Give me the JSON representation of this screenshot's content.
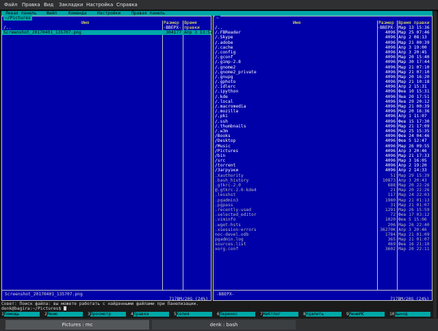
{
  "app_menu": [
    "Файл",
    "Правка",
    "Вид",
    "Закладки",
    "Настройка",
    "Справка"
  ],
  "mc_menu": [
    "Левая панель",
    "Файл",
    "Команда",
    "Настройки",
    "Правая панель"
  ],
  "left_panel": {
    "path": "~/Pictures",
    "col_name": "Имя",
    "col_size": "Размер",
    "col_time": "Время правки",
    "rows": [
      {
        "name": "/..",
        "size": "-ВВЕРХ-",
        "time": "",
        "kind": "dir"
      },
      {
        "name": " Screenshot_20170401_135707.png",
        "size": "304177",
        "time": "Апр  3 13:57",
        "kind": "sel"
      }
    ],
    "footer": "Screenshot_20170401_135707.png",
    "space": "717ВМ/20G (24%)"
  },
  "right_panel": {
    "path": "~",
    "col_name": "Имя",
    "col_size": "Размер",
    "col_time": "Время правки",
    "rows": [
      {
        "name": "/..",
        "size": "-ВВЕРХ-",
        "time": "Мар 13 15:36",
        "kind": "dir"
      },
      {
        "name": "/.FBReader",
        "size": "4096",
        "time": "Мар 25 07:46",
        "kind": "dir"
      },
      {
        "name": "/.Skype",
        "size": "4096",
        "time": "Апр  2 08:13",
        "kind": "dir"
      },
      {
        "name": "/.adobe",
        "size": "4096",
        "time": "Мар 21 00:39",
        "kind": "dir"
      },
      {
        "name": "/.cache",
        "size": "4096",
        "time": "Апр  3 19:00",
        "kind": "dir"
      },
      {
        "name": "/.config",
        "size": "4096",
        "time": "Апр  3 20:45",
        "kind": "dir"
      },
      {
        "name": "/.gconf",
        "size": "4096",
        "time": "Мар 20 15:40",
        "kind": "dir"
      },
      {
        "name": "/.gimp-2.8",
        "size": "4096",
        "time": "Мар 30 17:44",
        "kind": "dir"
      },
      {
        "name": "/.gnome2",
        "size": "4096",
        "time": "Мар 21 07:10",
        "kind": "dir"
      },
      {
        "name": "/.gnome2_private",
        "size": "4096",
        "time": "Мар 21 07:10",
        "kind": "dir"
      },
      {
        "name": "/.gnupg",
        "size": "4096",
        "time": "Мар 20 16:20",
        "kind": "dir"
      },
      {
        "name": "/.gphoto",
        "size": "4096",
        "time": "Мар 21 10:18",
        "kind": "dir"
      },
      {
        "name": "/.idlerc",
        "size": "4096",
        "time": "Апр  2 15:31",
        "kind": "dir"
      },
      {
        "name": "/.ipython",
        "size": "4096",
        "time": "Фев 10 15:31",
        "kind": "dir"
      },
      {
        "name": "/.kde",
        "size": "4096",
        "time": "Янв 20 17:51",
        "kind": "dir"
      },
      {
        "name": "/.local",
        "size": "4096",
        "time": "Янв 29 20:12",
        "kind": "dir"
      },
      {
        "name": "/.macromedia",
        "size": "4096",
        "time": "Мар 21 00:39",
        "kind": "dir"
      },
      {
        "name": "/.mozilla",
        "size": "4096",
        "time": "Мар 20 16:36",
        "kind": "dir"
      },
      {
        "name": "/.pki",
        "size": "4096",
        "time": "Апр  1 11:07",
        "kind": "dir"
      },
      {
        "name": "/.ssh",
        "size": "4096",
        "time": "Фев 15 17:30",
        "kind": "dir"
      },
      {
        "name": "/.thumbnails",
        "size": "4096",
        "time": "Мар 21 17:09",
        "kind": "dir"
      },
      {
        "name": "/.w3m",
        "size": "4096",
        "time": "Мар 25 15:35",
        "kind": "dir"
      },
      {
        "name": "/Books",
        "size": "4096",
        "time": "Фев 24 04:46",
        "kind": "dir"
      },
      {
        "name": "/Desktop",
        "size": "4096",
        "time": "Фев  5 12:47",
        "kind": "dir"
      },
      {
        "name": "/Music",
        "size": "4096",
        "time": "Мар 26 09:55",
        "kind": "dir"
      },
      {
        "name": "/Pictures",
        "size": "4096",
        "time": "Апр  3 20:46",
        "kind": "dir"
      },
      {
        "name": "/bin",
        "size": "4096",
        "time": "Мар 21 17:33",
        "kind": "dir"
      },
      {
        "name": "/src",
        "size": "4096",
        "time": "Мар  3 16:05",
        "kind": "dir"
      },
      {
        "name": "/torrent",
        "size": "4096",
        "time": "Апр  2 19:20",
        "kind": "dir"
      },
      {
        "name": "/Загрузки",
        "size": "4096",
        "time": "Апр  2 14:33",
        "kind": "dir"
      },
      {
        "name": " .Xauthority",
        "size": "51",
        "time": "Мар 29 15:39",
        "kind": "file"
      },
      {
        "name": " .bash_history",
        "size": "10873",
        "time": "Апр  3 20:43",
        "kind": "file"
      },
      {
        "name": " .gtkrc-2.0",
        "size": "688",
        "time": "Мар 20 22:26",
        "kind": "file"
      },
      {
        "name": "@.gtkrc-2.0-kde4",
        "size": "21",
        "time": "Мар 20 22:26",
        "kind": "file"
      },
      {
        "name": " .lesshst",
        "size": "117",
        "time": "Мар 24 22:03",
        "kind": "file"
      },
      {
        "name": " .pgadmin3",
        "size": "1980",
        "time": "Мар 21 01:13",
        "kind": "file"
      },
      {
        "name": " .pgpass",
        "size": "31",
        "time": "Мар 21 01:07",
        "kind": "file"
      },
      {
        "name": " .recently-used",
        "size": "1291",
        "time": "Мар 26 15:59",
        "kind": "file"
      },
      {
        "name": " .selected_editor",
        "size": "72",
        "time": "Фев 17 03:12",
        "kind": "file"
      },
      {
        "name": " .viminfo",
        "size": "1020",
        "time": "Фев  5 15:06",
        "kind": "file"
      },
      {
        "name": " .wget-hsts",
        "size": "206",
        "time": "Мар 26 22:40",
        "kind": "file"
      },
      {
        "name": " .xsession-errors",
        "size": "36270K",
        "time": "Апр  3 20:46",
        "kind": "file"
      },
      {
        "name": " noc-devel.odb",
        "size": "1784",
        "time": "Мар 21 01:09",
        "kind": "file"
      },
      {
        "name": " pgadmin.log",
        "size": "365",
        "time": "Мар 21 01:07",
        "kind": "file"
      },
      {
        "name": " sources.list",
        "size": "469",
        "time": "Фев 16 21:10",
        "kind": "file"
      },
      {
        "name": " xorg.conf",
        "size": "3602",
        "time": "Мар 20 22:11",
        "kind": "file"
      }
    ],
    "footer": "-ВВЕРХ-",
    "space": "717ВМ/20G (24%)"
  },
  "hint": "Совет: Поиск файла: вы можете работать с найденными файлами при Панелизации.",
  "prompt": "denk@bagira:~/Pictures$",
  "fkeys": [
    {
      "num": "1",
      "label": "Помощь"
    },
    {
      "num": "2",
      "label": "Меню"
    },
    {
      "num": "3",
      "label": "Просмотр"
    },
    {
      "num": "4",
      "label": "Правка"
    },
    {
      "num": "5",
      "label": "Копия"
    },
    {
      "num": "6",
      "label": "Перенос"
    },
    {
      "num": "7",
      "label": "НвКтлог"
    },
    {
      "num": "8",
      "label": "Удалить"
    },
    {
      "num": "9",
      "label": "МенюМС"
    },
    {
      "num": "10",
      "label": "Выход"
    }
  ],
  "taskbar": [
    {
      "label": "Pictures : mc",
      "active": true
    },
    {
      "label": "denk : bash",
      "active": false
    }
  ]
}
